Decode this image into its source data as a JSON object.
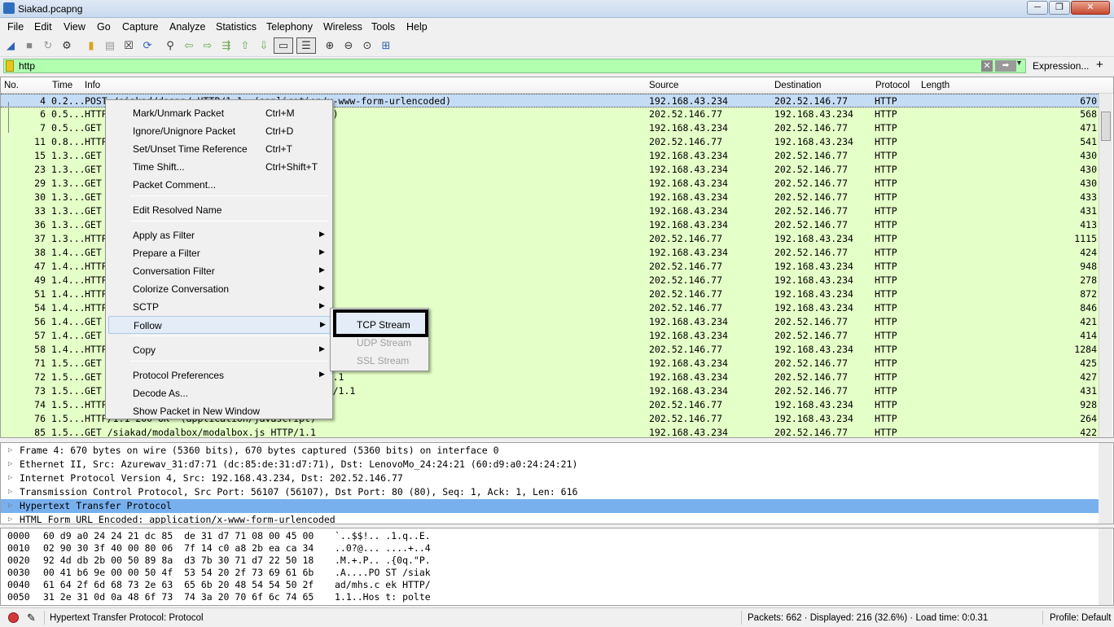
{
  "window": {
    "title": "Siakad.pcapng",
    "min": "─",
    "max": "❐",
    "close": "✕"
  },
  "menu": [
    "File",
    "Edit",
    "View",
    "Go",
    "Capture",
    "Analyze",
    "Statistics",
    "Telephony",
    "Wireless",
    "Tools",
    "Help"
  ],
  "filter": {
    "value": "http",
    "clear": "✕",
    "apply": "➡",
    "dropdown": "▼",
    "expression_label": "Expression...",
    "add_label": "+"
  },
  "packet_list": {
    "columns": [
      "No.",
      "Time",
      "Info",
      "Source",
      "Destination",
      "Protocol",
      "Length"
    ],
    "rows": [
      {
        "no": "4",
        "time": "0.2...",
        "info": "POST /siakad/doapp/ HTTP/1.1  (application/x-www-form-urlencoded)",
        "src": "192.168.43.234",
        "dst": "202.52.146.77",
        "proto": "HTTP",
        "len": "670"
      },
      {
        "no": "6",
        "time": "0.5...",
        "info": "HTTP                              (text/html)",
        "src": "202.52.146.77",
        "dst": "192.168.43.234",
        "proto": "HTTP",
        "len": "568"
      },
      {
        "no": "7",
        "time": "0.5...",
        "info": "GET",
        "src": "192.168.43.234",
        "dst": "202.52.146.77",
        "proto": "HTTP",
        "len": "471"
      },
      {
        "no": "11",
        "time": "0.8...",
        "info": "HTTP",
        "src": "202.52.146.77",
        "dst": "192.168.43.234",
        "proto": "HTTP",
        "len": "541"
      },
      {
        "no": "15",
        "time": "1.3...",
        "info": "GET",
        "src": "192.168.43.234",
        "dst": "202.52.146.77",
        "proto": "HTTP",
        "len": "430"
      },
      {
        "no": "23",
        "time": "1.3...",
        "info": "GET",
        "src": "192.168.43.234",
        "dst": "202.52.146.77",
        "proto": "HTTP",
        "len": "430"
      },
      {
        "no": "29",
        "time": "1.3...",
        "info": "GET",
        "src": "192.168.43.234",
        "dst": "202.52.146.77",
        "proto": "HTTP",
        "len": "430"
      },
      {
        "no": "30",
        "time": "1.3...",
        "info": "GET",
        "src": "192.168.43.234",
        "dst": "202.52.146.77",
        "proto": "HTTP",
        "len": "433"
      },
      {
        "no": "33",
        "time": "1.3...",
        "info": "GET",
        "src": "192.168.43.234",
        "dst": "202.52.146.77",
        "proto": "HTTP",
        "len": "431"
      },
      {
        "no": "36",
        "time": "1.3...",
        "info": "GET",
        "src": "192.168.43.234",
        "dst": "202.52.146.77",
        "proto": "HTTP",
        "len": "413"
      },
      {
        "no": "37",
        "time": "1.3...",
        "info": "HTTP",
        "src": "202.52.146.77",
        "dst": "192.168.43.234",
        "proto": "HTTP",
        "len": "1115"
      },
      {
        "no": "38",
        "time": "1.4...",
        "info": "GET",
        "src": "192.168.43.234",
        "dst": "202.52.146.77",
        "proto": "HTTP",
        "len": "424"
      },
      {
        "no": "47",
        "time": "1.4...",
        "info": "HTTP",
        "src": "202.52.146.77",
        "dst": "192.168.43.234",
        "proto": "HTTP",
        "len": "948"
      },
      {
        "no": "49",
        "time": "1.4...",
        "info": "HTTP",
        "src": "202.52.146.77",
        "dst": "192.168.43.234",
        "proto": "HTTP",
        "len": "278"
      },
      {
        "no": "51",
        "time": "1.4...",
        "info": "HTTP",
        "src": "202.52.146.77",
        "dst": "192.168.43.234",
        "proto": "HTTP",
        "len": "872"
      },
      {
        "no": "54",
        "time": "1.4...",
        "info": "HTTP",
        "src": "202.52.146.77",
        "dst": "192.168.43.234",
        "proto": "HTTP",
        "len": "846"
      },
      {
        "no": "56",
        "time": "1.4...",
        "info": "GET",
        "src": "192.168.43.234",
        "dst": "202.52.146.77",
        "proto": "HTTP",
        "len": "421"
      },
      {
        "no": "57",
        "time": "1.4...",
        "info": "GET",
        "src": "192.168.43.234",
        "dst": "202.52.146.77",
        "proto": "HTTP",
        "len": "414"
      },
      {
        "no": "58",
        "time": "1.4...",
        "info": "HTTP",
        "src": "202.52.146.77",
        "dst": "192.168.43.234",
        "proto": "HTTP",
        "len": "1284"
      },
      {
        "no": "71",
        "time": "1.5...",
        "info": "GET",
        "src": "192.168.43.234",
        "dst": "202.52.146.77",
        "proto": "HTTP",
        "len": "425"
      },
      {
        "no": "72",
        "time": "1.5...",
        "info": "GET                                         .1",
        "src": "192.168.43.234",
        "dst": "202.52.146.77",
        "proto": "HTTP",
        "len": "427"
      },
      {
        "no": "73",
        "time": "1.5...",
        "info": "GET                                       TP/1.1",
        "src": "192.168.43.234",
        "dst": "202.52.146.77",
        "proto": "HTTP",
        "len": "431"
      },
      {
        "no": "74",
        "time": "1.5...",
        "info": "HTTP",
        "src": "202.52.146.77",
        "dst": "192.168.43.234",
        "proto": "HTTP",
        "len": "928"
      },
      {
        "no": "76",
        "time": "1.5...",
        "info": "HTTP/1.1 200 OK  (application/javascript)",
        "src": "202.52.146.77",
        "dst": "192.168.43.234",
        "proto": "HTTP",
        "len": "264"
      },
      {
        "no": "85",
        "time": "1.5...",
        "info": "GET /siakad/modalbox/modalbox.js HTTP/1.1",
        "src": "192.168.43.234",
        "dst": "202.52.146.77",
        "proto": "HTTP",
        "len": "422"
      }
    ]
  },
  "details": [
    "Frame 4: 670 bytes on wire (5360 bits), 670 bytes captured (5360 bits) on interface 0",
    "Ethernet II, Src: Azurewav_31:d7:71 (dc:85:de:31:d7:71), Dst: LenovoMo_24:24:21 (60:d9:a0:24:24:21)",
    "Internet Protocol Version 4, Src: 192.168.43.234, Dst: 202.52.146.77",
    "Transmission Control Protocol, Src Port: 56107 (56107), Dst Port: 80 (80), Seq: 1, Ack: 1, Len: 616",
    "Hypertext Transfer Protocol",
    "HTML Form URL Encoded: application/x-www-form-urlencoded"
  ],
  "bytes": [
    {
      "off": "0000",
      "hex": "60 d9 a0 24 24 21 dc 85  de 31 d7 71 08 00 45 00",
      "ascii": "`..$$!.. .1.q..E."
    },
    {
      "off": "0010",
      "hex": "02 90 30 3f 40 00 80 06  7f 14 c0 a8 2b ea ca 34",
      "ascii": "..0?@... ....+..4"
    },
    {
      "off": "0020",
      "hex": "92 4d db 2b 00 50 89 8a  d3 7b 30 71 d7 22 50 18",
      "ascii": ".M.+.P.. .{0q.\"P."
    },
    {
      "off": "0030",
      "hex": "00 41 b6 9e 00 00 50 4f  53 54 20 2f 73 69 61 6b",
      "ascii": ".A....PO ST /siak"
    },
    {
      "off": "0040",
      "hex": "61 64 2f 6d 68 73 2e 63  65 6b 20 48 54 54 50 2f",
      "ascii": "ad/mhs.c ek HTTP/"
    },
    {
      "off": "0050",
      "hex": "31 2e 31 0d 0a 48 6f 73  74 3a 20 70 6f 6c 74 65",
      "ascii": "1.1..Hos t: polte"
    }
  ],
  "status": {
    "text": "Hypertext Transfer Protocol: Protocol",
    "packets": "Packets: 662 · Displayed: 216 (32.6%) · Load time: 0:0.31",
    "profile": "Profile: Default"
  },
  "context_menu": {
    "items": [
      {
        "label": "Mark/Unmark Packet",
        "shortcut": "Ctrl+M"
      },
      {
        "label": "Ignore/Unignore Packet",
        "shortcut": "Ctrl+D"
      },
      {
        "label": "Set/Unset Time Reference",
        "shortcut": "Ctrl+T"
      },
      {
        "label": "Time Shift...",
        "shortcut": "Ctrl+Shift+T"
      },
      {
        "label": "Packet Comment...",
        "shortcut": ""
      },
      {
        "label": "Edit Resolved Name",
        "shortcut": ""
      },
      {
        "label": "Apply as Filter",
        "shortcut": ""
      },
      {
        "label": "Prepare a Filter",
        "shortcut": ""
      },
      {
        "label": "Conversation Filter",
        "shortcut": ""
      },
      {
        "label": "Colorize Conversation",
        "shortcut": ""
      },
      {
        "label": "SCTP",
        "shortcut": ""
      },
      {
        "label": "Follow",
        "shortcut": ""
      },
      {
        "label": "Copy",
        "shortcut": ""
      },
      {
        "label": "Protocol Preferences",
        "shortcut": ""
      },
      {
        "label": "Decode As...",
        "shortcut": ""
      },
      {
        "label": "Show Packet in New Window",
        "shortcut": ""
      }
    ],
    "submenu_arrow": "▶"
  },
  "follow_submenu": [
    "TCP Stream",
    "UDP Stream",
    "SSL Stream"
  ],
  "colors": {
    "http_row": "#e4ffc7",
    "filter_valid": "#afffaf",
    "selected_detail": "#78b0ee"
  }
}
